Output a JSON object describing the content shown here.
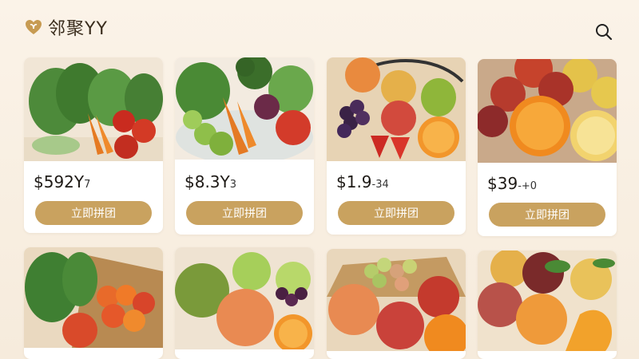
{
  "header": {
    "app_name": "邻聚YY",
    "logo_icon": "leaf-heart-icon",
    "search_icon": "search-icon"
  },
  "colors": {
    "background": "#f6ecdd",
    "button": "#c9a25f",
    "button_text": "#ffffff"
  },
  "products": [
    {
      "price": "$592Y",
      "price_suffix": "7",
      "button_label": "立即拼团",
      "image": "leafy-greens-carrots-tomatoes"
    },
    {
      "price": "$8.3Y",
      "price_suffix": "3",
      "button_label": "立即拼团",
      "image": "vegetable-plate-broccoli-carrots"
    },
    {
      "price": "$1.9",
      "price_suffix": "-34",
      "button_label": "立即拼团",
      "image": "fruit-basket-grapes-oranges"
    },
    {
      "price": "$39",
      "price_suffix": "-+0",
      "button_label": "立即拼团",
      "image": "apples-oranges-pears"
    },
    {
      "image": "vegetable-basket-tomatoes-greens"
    },
    {
      "image": "apples-grapes-orange"
    },
    {
      "image": "fruit-basket-grapes-apples"
    },
    {
      "image": "apples-pears-mango"
    }
  ]
}
